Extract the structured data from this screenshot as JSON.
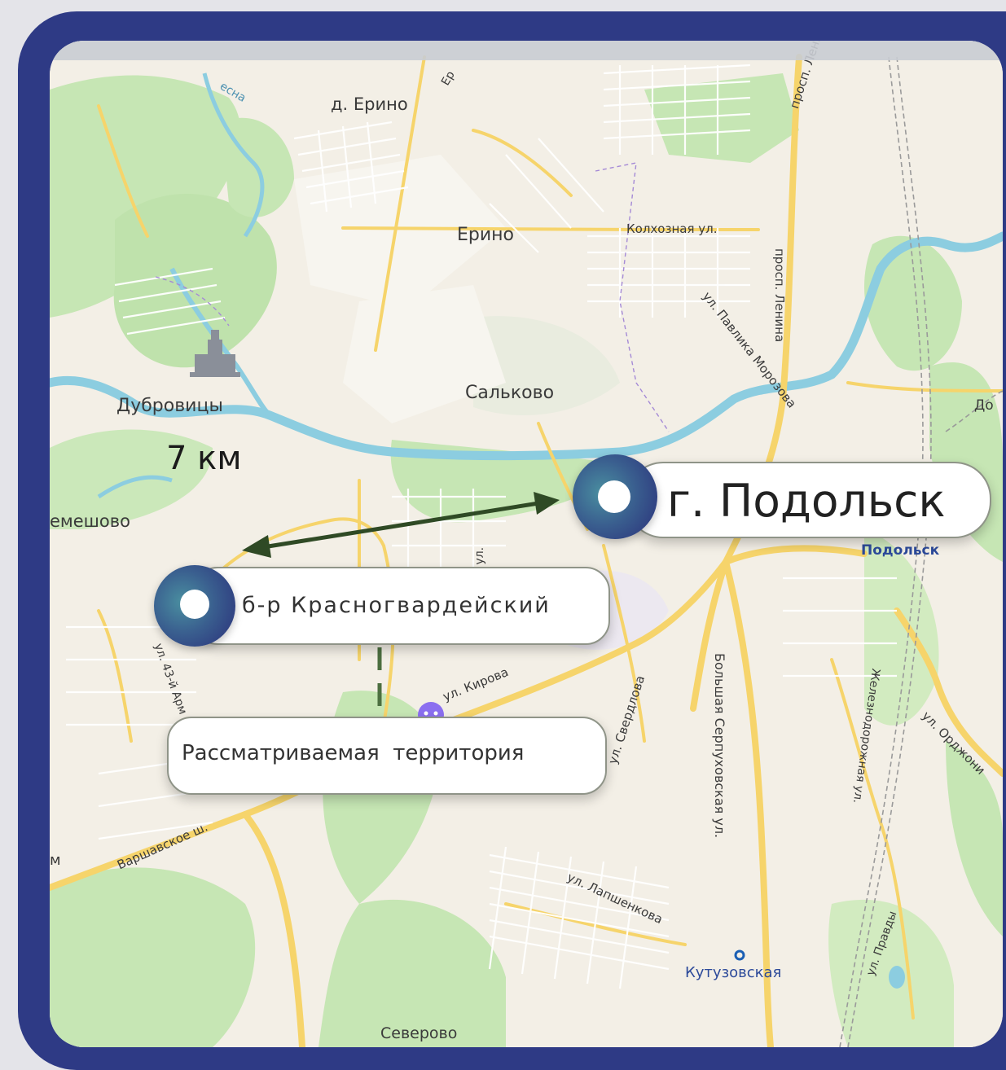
{
  "map": {
    "labels": {
      "erino_village": "д. Ерино",
      "erino": "Ерино",
      "kolkhoznaya": "Колхозная ул.",
      "lenina_top": "просп. Ленина",
      "lenina_mid": "просп. Ленина",
      "pavlika": "ул. Павлика Морозова",
      "salkovo": "Сальково",
      "dubrovitsy": "Дубровицы",
      "lemeshovo": "емешово",
      "podolsk_map": "Подольск",
      "kirova": "ул. Кирова",
      "sverdlova": "ул. Свердлова",
      "serpukhovskaya": "Большая Серпуховская ул.",
      "zheleznodorozhnaya": "Железнодорожная ул.",
      "ordzhonikidze": "ул. Орджони",
      "armii": "ул. 43-й Арм",
      "varshavskoe": "Варшавское ш.",
      "lapshenkova": "ул. Лапшенкова",
      "pravdy": "ул. Правды",
      "kutuzovskaya": "Кутузовская",
      "severovo": "Северово",
      "do_edge": "До",
      "ya_ul": "ая ул.",
      "er_top": "Ер",
      "esna": "есна",
      "m_edge": "м"
    },
    "distance": "7 км",
    "callouts": {
      "podolsk": "г. Подольск",
      "krasnogvardeysky": "б-р Красногвардейский",
      "territory": "Рассматриваемая  территория"
    }
  },
  "colors": {
    "frame": "#2e3a85",
    "river": "#8ccde0",
    "forest": "#c6e6b4",
    "road_major": "#f6d46b",
    "arrow": "#2f4a25"
  }
}
